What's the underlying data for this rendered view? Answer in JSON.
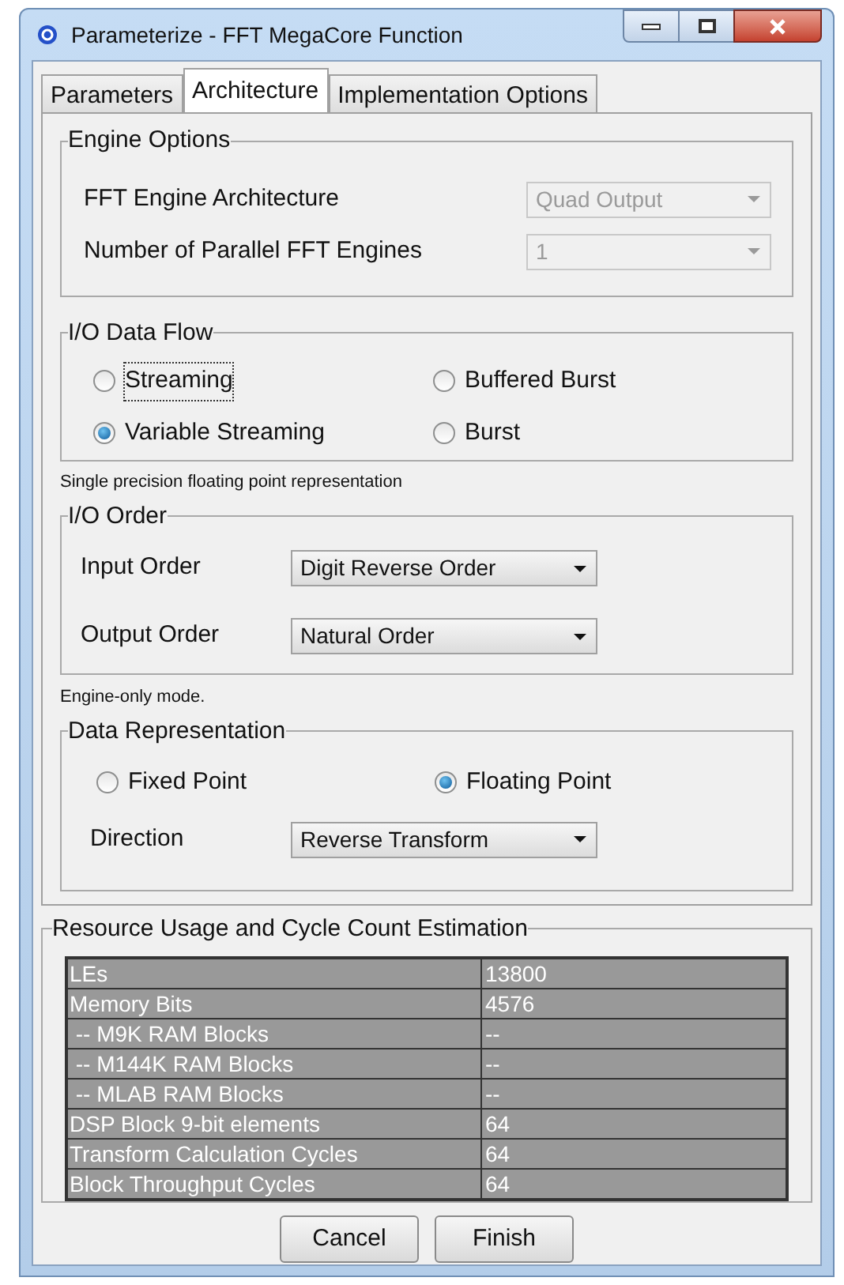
{
  "window": {
    "title": "Parameterize - FFT MegaCore Function"
  },
  "tabs": [
    {
      "label": "Parameters",
      "selected": false
    },
    {
      "label": "Architecture",
      "selected": true
    },
    {
      "label": "Implementation Options",
      "selected": false
    }
  ],
  "engine_options": {
    "title": "Engine Options",
    "fields": [
      {
        "label": "FFT Engine Architecture",
        "value": "Quad Output",
        "disabled": true
      },
      {
        "label": "Number of Parallel FFT Engines",
        "value": "1",
        "disabled": true
      }
    ]
  },
  "io_data_flow": {
    "title": "I/O Data Flow",
    "options": [
      {
        "label": "Streaming",
        "selected": false,
        "focused": true
      },
      {
        "label": "Buffered Burst",
        "selected": false,
        "focused": false
      },
      {
        "label": "Variable Streaming",
        "selected": true,
        "focused": false
      },
      {
        "label": "Burst",
        "selected": false,
        "focused": false
      }
    ]
  },
  "precision_note": "Single precision floating point representation",
  "io_order": {
    "title": "I/O Order",
    "fields": [
      {
        "label": "Input Order",
        "value": "Digit Reverse Order",
        "disabled": false
      },
      {
        "label": "Output Order",
        "value": "Natural Order",
        "disabled": false
      }
    ]
  },
  "mode_note": "Engine-only mode.",
  "data_representation": {
    "title": "Data Representation",
    "options": [
      {
        "label": "Fixed Point",
        "selected": false,
        "focused": false
      },
      {
        "label": "Floating Point",
        "selected": true,
        "focused": false
      }
    ],
    "direction": {
      "label": "Direction",
      "value": "Reverse Transform",
      "disabled": false
    }
  },
  "resource_estimation": {
    "title": "Resource Usage and Cycle Count Estimation",
    "rows": [
      {
        "name": "LEs",
        "value": "13800"
      },
      {
        "name": "Memory Bits",
        "value": "4576"
      },
      {
        "name": " -- M9K RAM Blocks",
        "value": "--"
      },
      {
        "name": " -- M144K RAM Blocks",
        "value": "--"
      },
      {
        "name": " -- MLAB RAM Blocks",
        "value": "--"
      },
      {
        "name": "DSP Block 9-bit elements",
        "value": "64"
      },
      {
        "name": "Transform Calculation Cycles",
        "value": "64"
      },
      {
        "name": "Block Throughput Cycles",
        "value": "64"
      }
    ]
  },
  "buttons": [
    "Cancel",
    "Finish"
  ]
}
